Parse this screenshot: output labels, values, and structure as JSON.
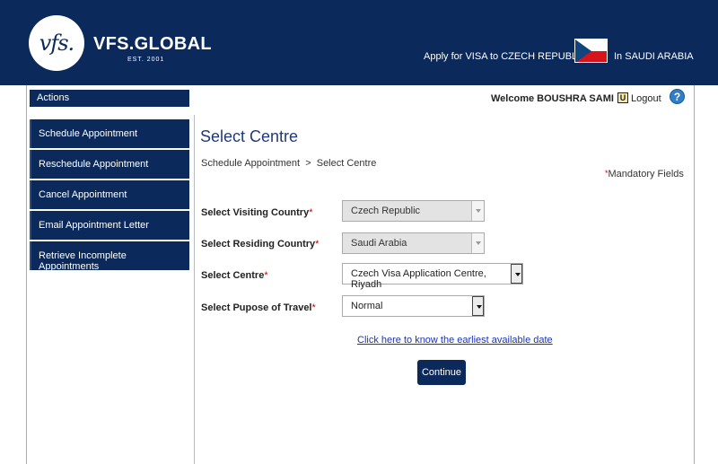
{
  "header": {
    "logo_mark": "vfs.",
    "logo_text": "VFS.GLOBAL",
    "logo_est": "EST. 2001",
    "apply_text": "Apply for VISA to CZECH REPUBLIC",
    "flag_icon": "czech-flag-icon",
    "in_text": "In SAUDI ARABIA"
  },
  "topbar": {
    "welcome": "Welcome BOUSHRA SAMI !",
    "logout_icon": "U",
    "logout": "Logout",
    "help": "?"
  },
  "sidebar": {
    "header": "Actions",
    "items": [
      {
        "label": "Schedule Appointment"
      },
      {
        "label": "Reschedule Appointment"
      },
      {
        "label": "Cancel Appointment"
      },
      {
        "label": "Email Appointment Letter"
      },
      {
        "label": "Retrieve Incomplete Appointments"
      }
    ]
  },
  "main": {
    "title": "Select Centre",
    "breadcrumb": "Schedule Appointment  >  Select Centre",
    "mandatory_star": "*",
    "mandatory": "Mandatory Fields",
    "fields": [
      {
        "label": "Select Visiting Country",
        "star": "*",
        "value": "Czech Republic"
      },
      {
        "label": "Select Residing Country",
        "star": "*",
        "value": "Saudi Arabia"
      },
      {
        "label": "Select Centre",
        "star": "*",
        "value": "Czech Visa Application Centre, Riyadh"
      },
      {
        "label": "Select Pupose of Travel",
        "star": "*",
        "value": "Normal"
      }
    ],
    "earliest_link": "Click here to know the earliest available date",
    "continue": "Continue"
  }
}
